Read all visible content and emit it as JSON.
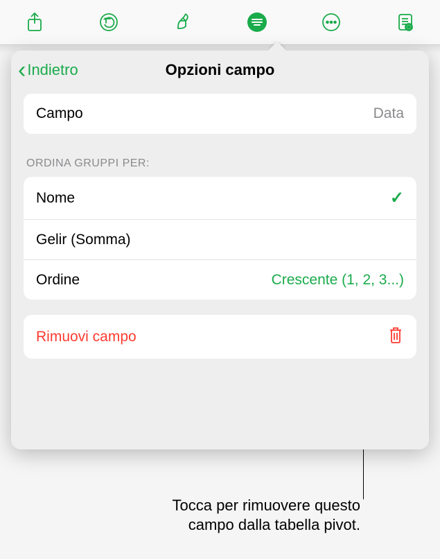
{
  "toolbar": {
    "icons": [
      "share",
      "undo",
      "format-brush",
      "pivot",
      "more",
      "read-mode"
    ]
  },
  "popover": {
    "back_label": "Indietro",
    "title": "Opzioni campo",
    "field_row": {
      "label": "Campo",
      "value": "Data"
    },
    "sort_header": "ORDINA GRUPPI PER:",
    "sort_options": [
      {
        "label": "Nome",
        "checked": true
      },
      {
        "label": "Gelir (Somma)",
        "checked": false
      }
    ],
    "order_row": {
      "label": "Ordine",
      "value": "Crescente (1, 2, 3...)"
    },
    "remove_label": "Rimuovi campo"
  },
  "callout": {
    "line1": "Tocca per rimuovere questo",
    "line2": "campo dalla tabella pivot."
  }
}
